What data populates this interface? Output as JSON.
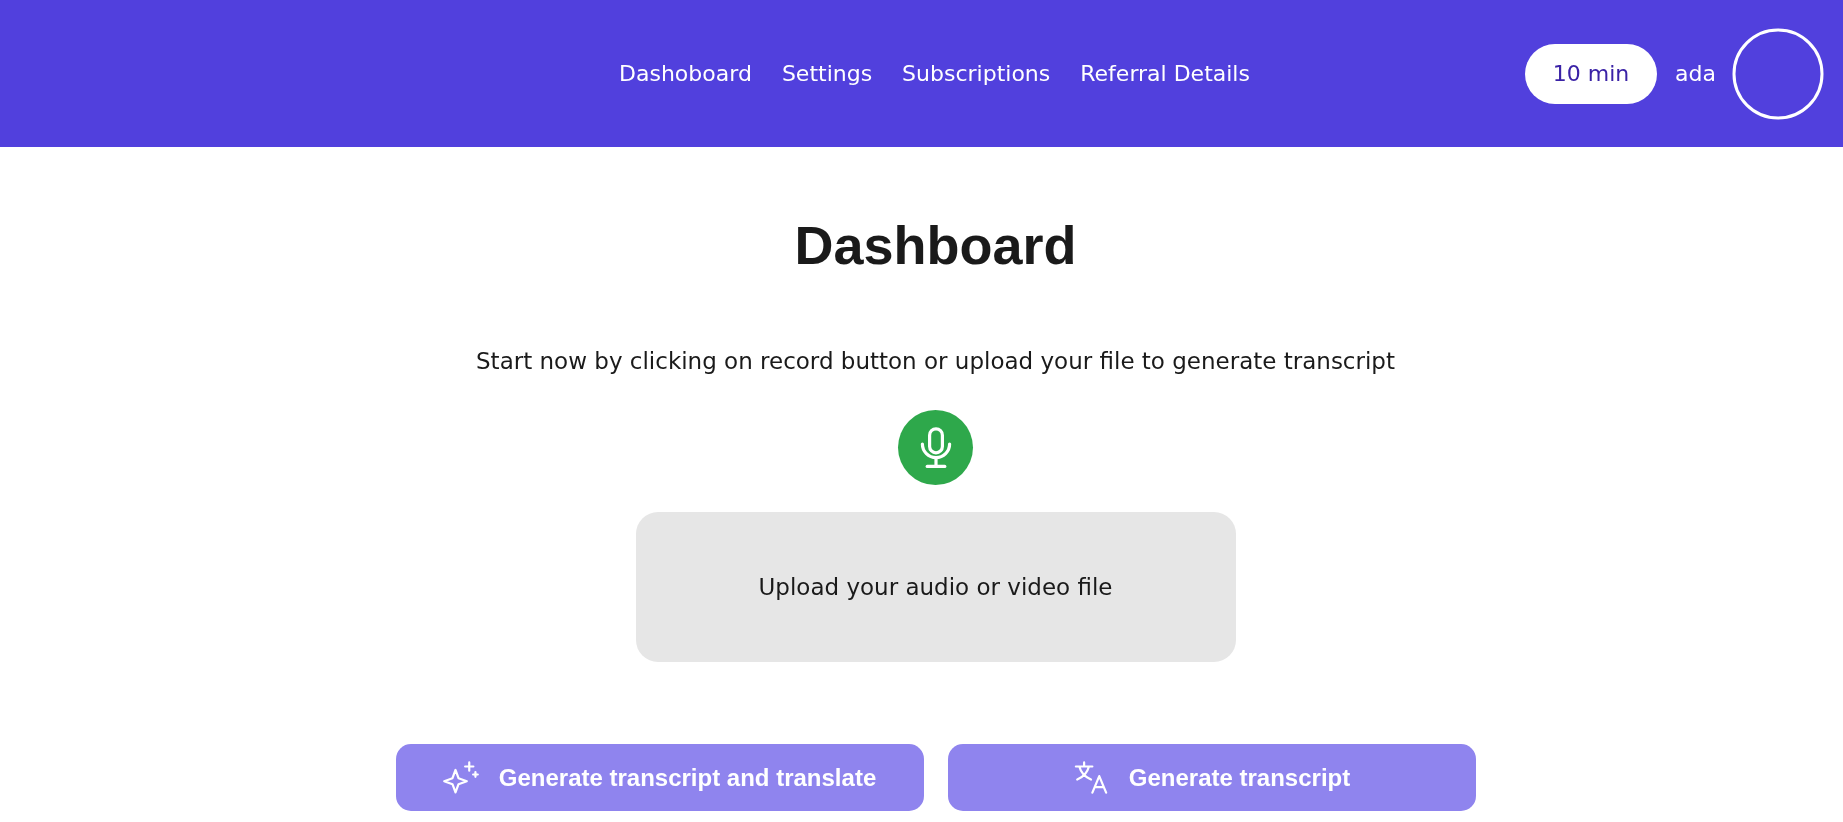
{
  "header": {
    "nav": [
      {
        "label": "Dashoboard",
        "selected": false
      },
      {
        "label": "Settings",
        "selected": false
      },
      {
        "label": "Subscriptions",
        "selected": false
      },
      {
        "label": "Referral Details",
        "selected": false
      }
    ],
    "minutes_badge": "10 min",
    "username": "ada"
  },
  "main": {
    "title": "Dashboard",
    "instruction": "Start now by clicking on record button or upload your file to generate transcript",
    "upload": {
      "label": "Upload your audio or video file"
    },
    "actions": [
      {
        "kind": "translate",
        "label": "Generate transcript and translate",
        "disabled": true
      },
      {
        "kind": "transcript",
        "label": "Generate transcript",
        "disabled": true
      }
    ]
  }
}
